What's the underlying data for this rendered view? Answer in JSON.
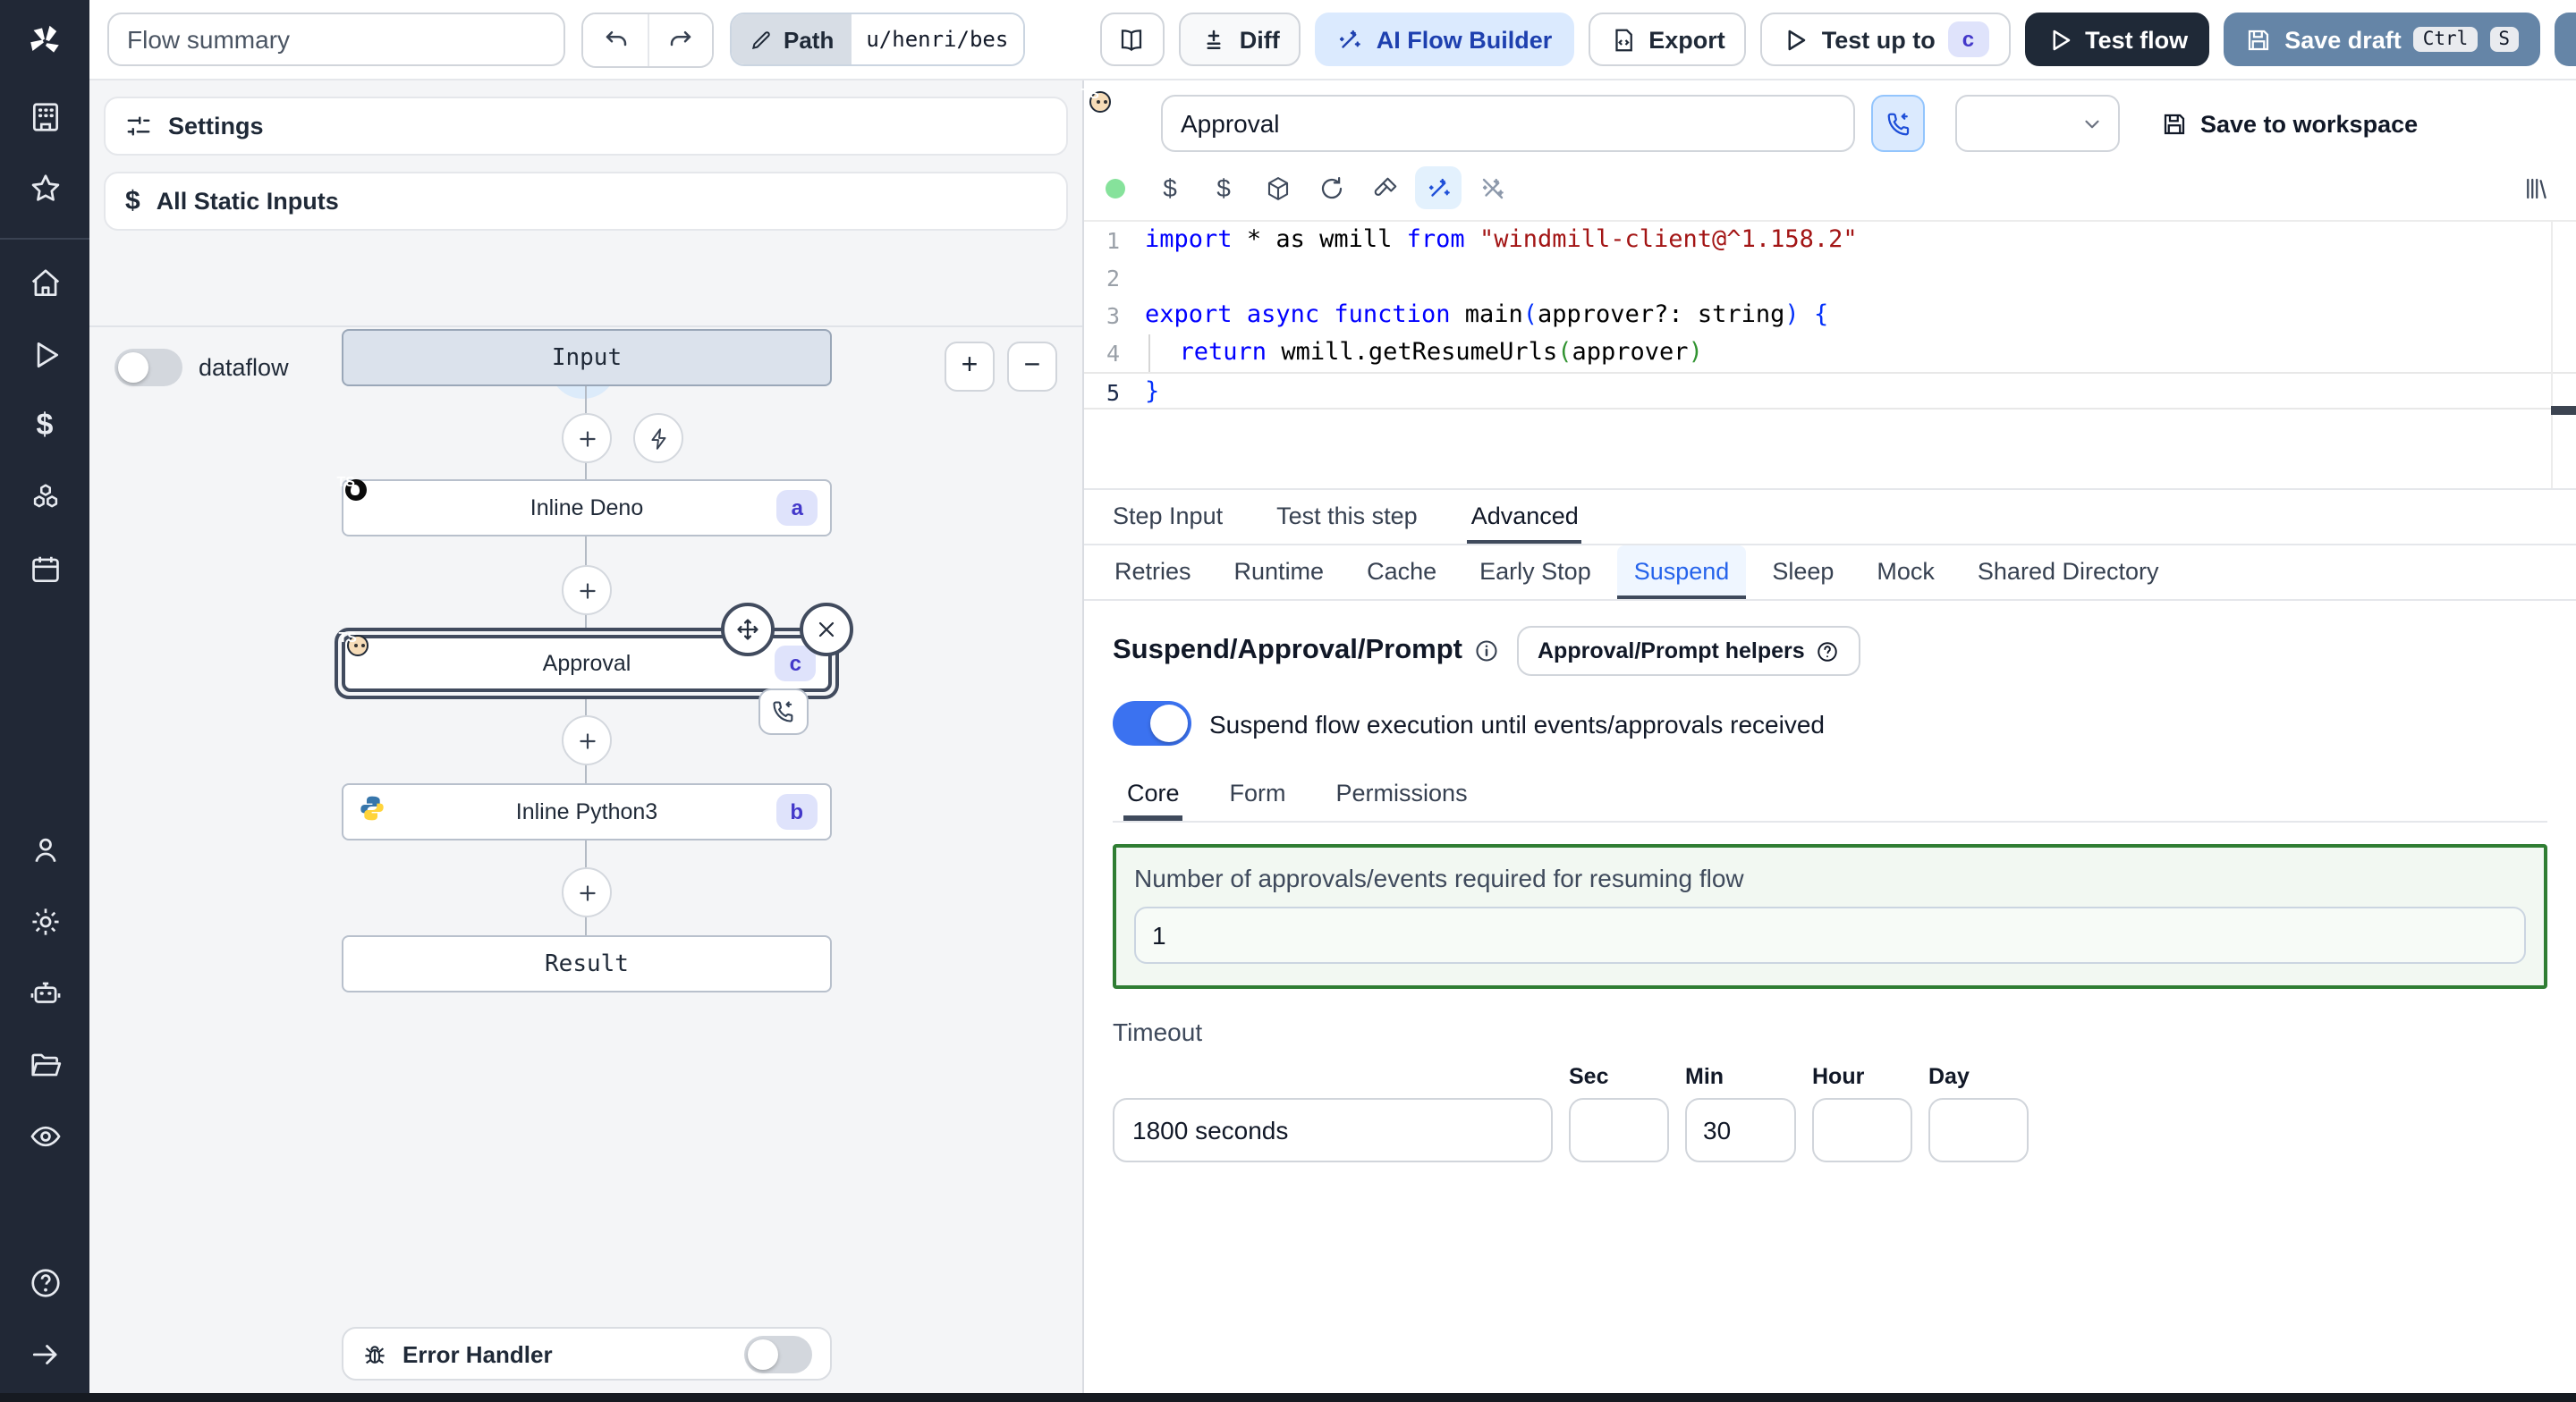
{
  "topbar": {
    "flow_summary_placeholder": "Flow summary",
    "path_label": "Path",
    "path_value": "u/henri/bes",
    "diff_label": "Diff",
    "ai_flow_builder_label": "AI Flow Builder",
    "export_label": "Export",
    "test_up_to_label": "Test up to",
    "test_up_to_badge": "c",
    "test_flow_label": "Test flow",
    "save_draft_label": "Save draft",
    "save_draft_keys": [
      "Ctrl",
      "S"
    ]
  },
  "flow_panel": {
    "settings_label": "Settings",
    "static_inputs_label": "All Static Inputs",
    "dataflow_label": "dataflow",
    "nodes": {
      "input": {
        "label": "Input"
      },
      "deno": {
        "label": "Inline Deno",
        "badge": "a"
      },
      "approval": {
        "label": "Approval",
        "badge": "c"
      },
      "python": {
        "label": "Inline Python3",
        "badge": "b"
      },
      "result": {
        "label": "Result"
      }
    },
    "error_handler_label": "Error Handler"
  },
  "step_panel": {
    "step_name": "Approval",
    "save_to_workspace_label": "Save to workspace",
    "editor": {
      "active_line": 5,
      "lines": [
        [
          [
            "kw",
            "import"
          ],
          [
            "d",
            " * as wmill "
          ],
          [
            "kw",
            "from"
          ],
          [
            "d",
            " "
          ],
          [
            "str",
            "\"windmill-client@^1.158.2\""
          ]
        ],
        [],
        [
          [
            "kw",
            "export"
          ],
          [
            "d",
            " "
          ],
          [
            "kw",
            "async"
          ],
          [
            "d",
            " "
          ],
          [
            "kw",
            "function"
          ],
          [
            "d",
            " main"
          ],
          [
            "pb",
            "("
          ],
          [
            "d",
            "approver?: string"
          ],
          [
            "pb",
            ")"
          ],
          [
            "d",
            " "
          ],
          [
            "pb",
            "{"
          ]
        ],
        [
          [
            "guide",
            ""
          ],
          [
            "d",
            "  "
          ],
          [
            "kw",
            "return"
          ],
          [
            "d",
            " wmill.getResumeUrls"
          ],
          [
            "pg",
            "("
          ],
          [
            "d",
            "approver"
          ],
          [
            "pg",
            ")"
          ]
        ],
        [
          [
            "pb",
            "}"
          ]
        ]
      ]
    },
    "tabs": [
      "Step Input",
      "Test this step",
      "Advanced"
    ],
    "active_tab": "Advanced",
    "subtabs": [
      "Retries",
      "Runtime",
      "Cache",
      "Early Stop",
      "Suspend",
      "Sleep",
      "Mock",
      "Shared Directory"
    ],
    "active_subtab": "Suspend",
    "suspend": {
      "title": "Suspend/Approval/Prompt",
      "helpers_button_label": "Approval/Prompt helpers",
      "toggle_label": "Suspend flow execution until events/approvals received",
      "toggle_on": true,
      "tabs": [
        "Core",
        "Form",
        "Permissions"
      ],
      "active_tab": "Core",
      "approvals_label": "Number of approvals/events required for resuming flow",
      "approvals_value": "1",
      "timeout_label": "Timeout",
      "timeout_value": "1800 seconds",
      "units": [
        "Sec",
        "Min",
        "Hour",
        "Day"
      ],
      "unit_values": {
        "sec": "",
        "min": "30",
        "hour": "",
        "day": ""
      }
    }
  },
  "colors": {
    "rail_bg": "#212836",
    "accent_blue": "#3b72f0",
    "ai_button_bg": "#dbeafe",
    "ai_button_text": "#1e40af",
    "dark_button_bg": "#1f2937",
    "save_draft_bg": "#6585a7",
    "badge_bg": "#dfe3fb",
    "badge_text": "#4338ca",
    "selected_node_border": "#414b5e",
    "approvals_box_border": "#2f7d33",
    "lang_status_dot": "#86e29b"
  }
}
